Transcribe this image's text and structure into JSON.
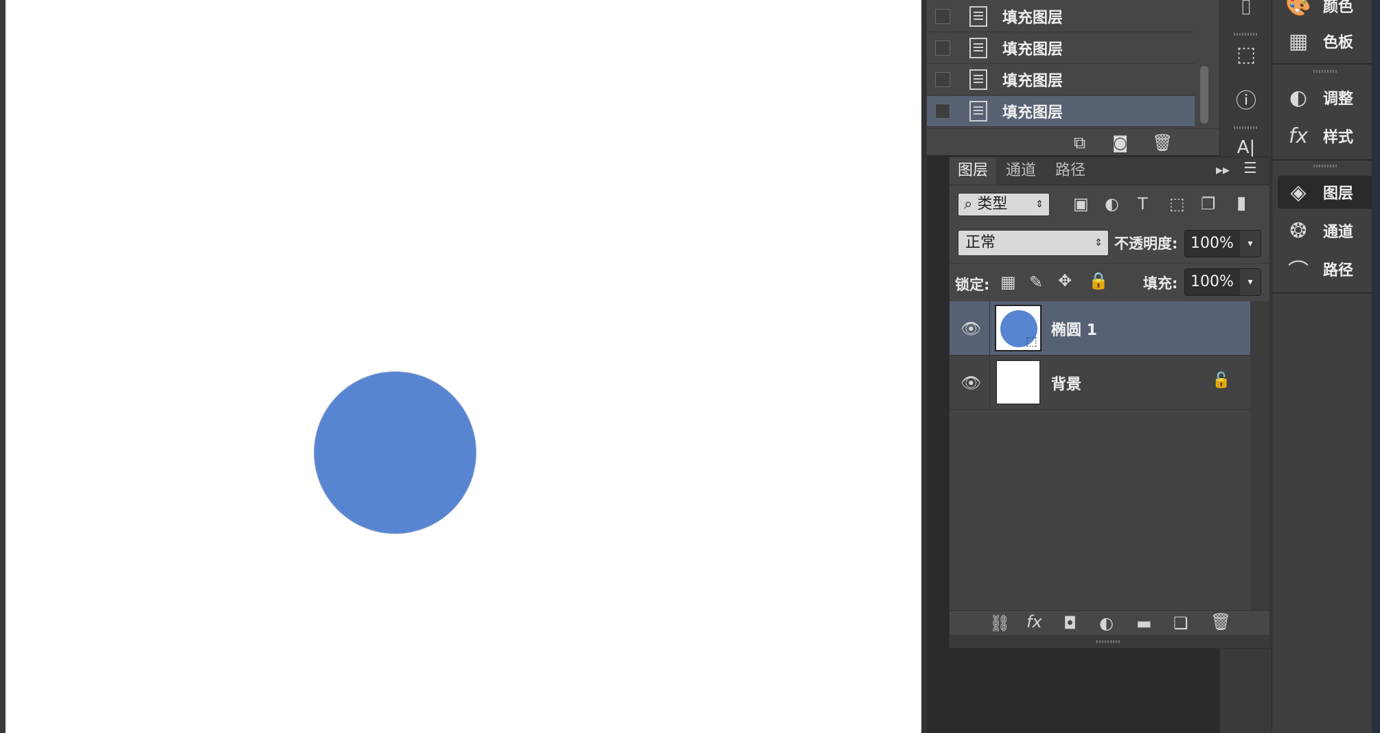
{
  "history": {
    "items": [
      {
        "label": "填充图层"
      },
      {
        "label": "填充图层"
      },
      {
        "label": "填充图层"
      },
      {
        "label": "填充图层",
        "selected": true
      }
    ]
  },
  "layers_panel": {
    "tabs": [
      "图层",
      "通道",
      "路径"
    ],
    "filter_label": "类型",
    "blend_mode": "正常",
    "opacity_label": "不透明度:",
    "opacity_value": "100%",
    "lock_label": "锁定:",
    "fill_label": "填充:",
    "fill_value": "100%",
    "layers": [
      {
        "name": "椭圆 1",
        "selected": true,
        "visible": true
      },
      {
        "name": "背景",
        "locked": true,
        "visible": true
      }
    ]
  },
  "dock": {
    "items": [
      "颜色",
      "色板",
      "调整",
      "样式",
      "图层",
      "通道",
      "路径"
    ],
    "active": "图层"
  },
  "canvas": {
    "shape_color": "#5785d2",
    "background": "#ffffff"
  }
}
